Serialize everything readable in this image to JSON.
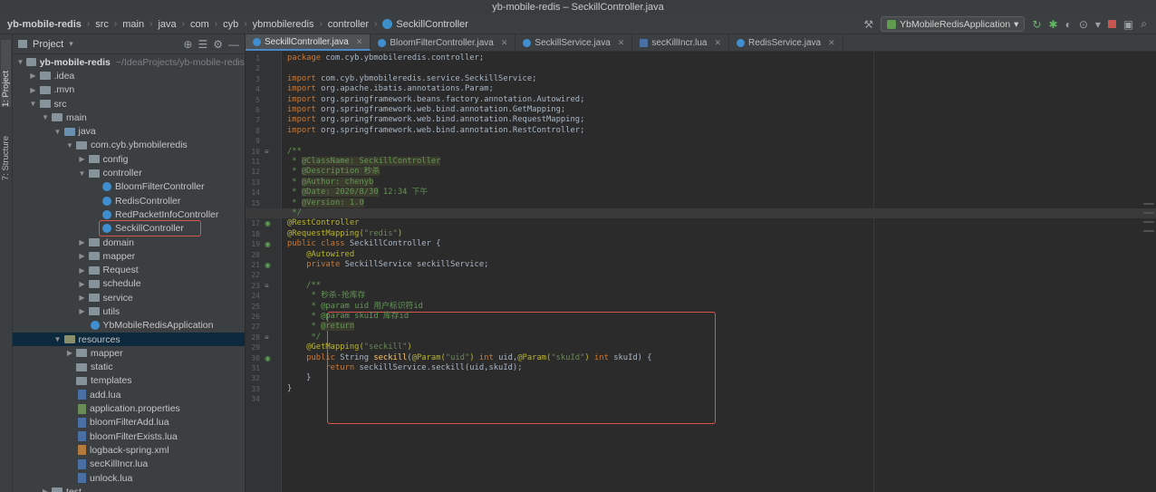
{
  "window": {
    "title": "yb-mobile-redis – SeckillController.java"
  },
  "navbar": {
    "breadcrumbs": [
      "yb-mobile-redis",
      "src",
      "main",
      "java",
      "com",
      "cyb",
      "ybmobileredis",
      "controller",
      "SeckillController"
    ],
    "run_config": "YbMobileRedisApplication"
  },
  "tool_windows": {
    "project": "1: Project",
    "structure": "7: Structure"
  },
  "project_panel": {
    "title": "Project",
    "tree": [
      {
        "label": "yb-mobile-redis",
        "path": "~/IdeaProjects/yb-mobile-redis",
        "depth": 0,
        "kind": "module",
        "open": true
      },
      {
        "label": ".idea",
        "depth": 1,
        "kind": "folder",
        "open": false
      },
      {
        "label": ".mvn",
        "depth": 1,
        "kind": "folder",
        "open": false
      },
      {
        "label": "src",
        "depth": 1,
        "kind": "folder",
        "open": true
      },
      {
        "label": "main",
        "depth": 2,
        "kind": "folder",
        "open": true
      },
      {
        "label": "java",
        "depth": 3,
        "kind": "src",
        "open": true
      },
      {
        "label": "com.cyb.ybmobileredis",
        "depth": 4,
        "kind": "folder",
        "open": true
      },
      {
        "label": "config",
        "depth": 5,
        "kind": "folder",
        "open": false
      },
      {
        "label": "controller",
        "depth": 5,
        "kind": "folder",
        "open": true
      },
      {
        "label": "BloomFilterController",
        "depth": 6,
        "kind": "class"
      },
      {
        "label": "RedisController",
        "depth": 6,
        "kind": "class"
      },
      {
        "label": "RedPacketInfoController",
        "depth": 6,
        "kind": "class"
      },
      {
        "label": "SeckillController",
        "depth": 6,
        "kind": "class",
        "highlighted": true
      },
      {
        "label": "domain",
        "depth": 5,
        "kind": "folder",
        "open": false
      },
      {
        "label": "mapper",
        "depth": 5,
        "kind": "folder",
        "open": false
      },
      {
        "label": "Request",
        "depth": 5,
        "kind": "folder",
        "open": false
      },
      {
        "label": "schedule",
        "depth": 5,
        "kind": "folder",
        "open": false
      },
      {
        "label": "service",
        "depth": 5,
        "kind": "folder",
        "open": false
      },
      {
        "label": "utils",
        "depth": 5,
        "kind": "folder",
        "open": false
      },
      {
        "label": "YbMobileRedisApplication",
        "depth": 5,
        "kind": "class"
      },
      {
        "label": "resources",
        "depth": 3,
        "kind": "res",
        "open": true,
        "selected": true
      },
      {
        "label": "mapper",
        "depth": 4,
        "kind": "folder",
        "open": false
      },
      {
        "label": "static",
        "depth": 4,
        "kind": "folder",
        "leaf": true
      },
      {
        "label": "templates",
        "depth": 4,
        "kind": "folder",
        "leaf": true
      },
      {
        "label": "add.lua",
        "depth": 4,
        "kind": "lua"
      },
      {
        "label": "application.properties",
        "depth": 4,
        "kind": "prop"
      },
      {
        "label": "bloomFilterAdd.lua",
        "depth": 4,
        "kind": "lua"
      },
      {
        "label": "bloomFilterExists.lua",
        "depth": 4,
        "kind": "lua"
      },
      {
        "label": "logback-spring.xml",
        "depth": 4,
        "kind": "xml"
      },
      {
        "label": "secKillIncr.lua",
        "depth": 4,
        "kind": "lua"
      },
      {
        "label": "unlock.lua",
        "depth": 4,
        "kind": "lua"
      },
      {
        "label": "test",
        "depth": 2,
        "kind": "folder",
        "open": false
      }
    ]
  },
  "editor": {
    "tabs": [
      {
        "label": "SeckillController.java",
        "kind": "class",
        "active": true
      },
      {
        "label": "BloomFilterController.java",
        "kind": "class"
      },
      {
        "label": "SeckillService.java",
        "kind": "class"
      },
      {
        "label": "secKillIncr.lua",
        "kind": "lua"
      },
      {
        "label": "RedisService.java",
        "kind": "class"
      }
    ],
    "lines": [
      {
        "n": "1",
        "segs": [
          [
            "kw",
            "package "
          ],
          [
            "code",
            "com.cyb.ybmobileredis.controller;"
          ]
        ]
      },
      {
        "n": "2",
        "segs": []
      },
      {
        "n": "3",
        "segs": [
          [
            "kw",
            "import "
          ],
          [
            "code",
            "com.cyb.ybmobileredis.service.SeckillService;"
          ]
        ]
      },
      {
        "n": "4",
        "segs": [
          [
            "kw",
            "import "
          ],
          [
            "code",
            "org.apache.ibatis.annotations.Param;"
          ]
        ]
      },
      {
        "n": "5",
        "segs": [
          [
            "kw",
            "import "
          ],
          [
            "code",
            "org.springframework.beans.factory.annotation.Autowired;"
          ]
        ]
      },
      {
        "n": "6",
        "segs": [
          [
            "kw",
            "import "
          ],
          [
            "code",
            "org.springframework.web.bind.annotation.GetMapping;"
          ]
        ]
      },
      {
        "n": "7",
        "segs": [
          [
            "kw",
            "import "
          ],
          [
            "code",
            "org.springframework.web.bind.annotation.RequestMapping;"
          ]
        ]
      },
      {
        "n": "8",
        "segs": [
          [
            "kw",
            "import "
          ],
          [
            "code",
            "org.springframework.web.bind.annotation.RestController;"
          ]
        ]
      },
      {
        "n": "9",
        "segs": []
      },
      {
        "n": "10",
        "segs": [
          [
            "cmt",
            "/**"
          ]
        ]
      },
      {
        "n": "11",
        "segs": [
          [
            "cmt",
            " * "
          ],
          [
            "tag",
            "@ClassName: SeckillController"
          ]
        ]
      },
      {
        "n": "12",
        "segs": [
          [
            "cmt",
            " * "
          ],
          [
            "tag",
            "@Description 秒杀"
          ]
        ]
      },
      {
        "n": "13",
        "segs": [
          [
            "cmt",
            " * "
          ],
          [
            "tag",
            "@Author: chenyb"
          ]
        ]
      },
      {
        "n": "14",
        "segs": [
          [
            "cmt",
            " * "
          ],
          [
            "tag",
            "@Date: 2020/8/30"
          ],
          [
            "cmt",
            " 12:34 下午"
          ]
        ]
      },
      {
        "n": "15",
        "segs": [
          [
            "cmt",
            " * "
          ],
          [
            "tag",
            "@Version: 1.0"
          ]
        ]
      },
      {
        "n": "16",
        "segs": [
          [
            "cmt",
            " */"
          ]
        ],
        "highlight": true
      },
      {
        "n": "17",
        "segs": [
          [
            "ann",
            "@RestController"
          ]
        ]
      },
      {
        "n": "18",
        "segs": [
          [
            "ann",
            "@RequestMapping("
          ],
          [
            "str",
            "\"redis\""
          ],
          [
            "ann",
            ")"
          ]
        ]
      },
      {
        "n": "19",
        "segs": [
          [
            "kw",
            "public class "
          ],
          [
            "code",
            "SeckillController {"
          ]
        ]
      },
      {
        "n": "20",
        "segs": [
          [
            "code",
            "    "
          ],
          [
            "ann",
            "@Autowired"
          ]
        ]
      },
      {
        "n": "21",
        "segs": [
          [
            "code",
            "    "
          ],
          [
            "kw",
            "private "
          ],
          [
            "code",
            "SeckillService seckillService;"
          ]
        ]
      },
      {
        "n": "22",
        "segs": []
      },
      {
        "n": "23",
        "segs": [
          [
            "cmt",
            "    /**"
          ]
        ]
      },
      {
        "n": "24",
        "segs": [
          [
            "cmt",
            "     * 秒杀-抢库存"
          ]
        ]
      },
      {
        "n": "25",
        "segs": [
          [
            "cmt",
            "     * @param uid 用户标识符id"
          ]
        ]
      },
      {
        "n": "26",
        "segs": [
          [
            "cmt",
            "     * @param skuId 库存id"
          ]
        ]
      },
      {
        "n": "27",
        "segs": [
          [
            "cmt",
            "     * "
          ],
          [
            "tag",
            "@return"
          ]
        ]
      },
      {
        "n": "28",
        "segs": [
          [
            "cmt",
            "     */"
          ]
        ]
      },
      {
        "n": "29",
        "segs": [
          [
            "code",
            "    "
          ],
          [
            "ann",
            "@GetMapping("
          ],
          [
            "str",
            "\"seckill\""
          ],
          [
            "ann",
            ")"
          ]
        ]
      },
      {
        "n": "30",
        "segs": [
          [
            "code",
            "    "
          ],
          [
            "kw",
            "public "
          ],
          [
            "code",
            "String "
          ],
          [
            "fn",
            "seckill"
          ],
          [
            "code",
            "("
          ],
          [
            "ann",
            "@Param("
          ],
          [
            "str",
            "\"uid\""
          ],
          [
            "ann",
            ") "
          ],
          [
            "kw",
            "int "
          ],
          [
            "code",
            "uid,"
          ],
          [
            "ann",
            "@Param("
          ],
          [
            "str",
            "\"skuId\""
          ],
          [
            "ann",
            ") "
          ],
          [
            "kw",
            "int "
          ],
          [
            "code",
            "skuId) {"
          ]
        ]
      },
      {
        "n": "31",
        "segs": [
          [
            "code",
            "        "
          ],
          [
            "kw",
            "return "
          ],
          [
            "code",
            "seckillService.seckill(uid,skuId);"
          ]
        ]
      },
      {
        "n": "32",
        "segs": [
          [
            "code",
            "    }"
          ]
        ]
      },
      {
        "n": "33",
        "segs": [
          [
            "code",
            "}"
          ]
        ]
      },
      {
        "n": "34",
        "segs": []
      }
    ]
  },
  "colors": {
    "accent": "#4a88c7",
    "callout": "#d9534f"
  }
}
